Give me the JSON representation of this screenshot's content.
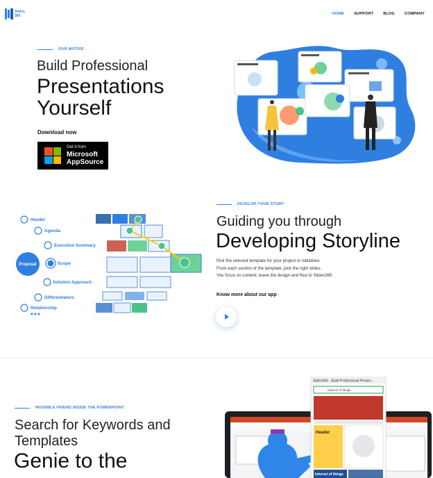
{
  "brand": {
    "logo_text_line1": "Slides",
    "logo_text_line2": "365"
  },
  "nav": {
    "items": [
      "HOME",
      "SUPPORT",
      "BLOG",
      "COMPANY"
    ],
    "active": "HOME"
  },
  "hero": {
    "eyebrow": "OUR MOTIVE",
    "line1": "Build Professional",
    "line2": "Presentations",
    "line3": "Yourself",
    "download_label": "Download now",
    "badge_small": "Get it from",
    "badge_big1": "Microsoft",
    "badge_big2": "AppSource"
  },
  "story": {
    "eyebrow": "DEVELOP YOUR STORY",
    "line1": "Guiding you through",
    "line2": "Developing Storyline",
    "body1": "Pick the relevant template for your project or initiatives",
    "body2": "From each section of the template, pick the right slides.",
    "body3": "You focus on content, leave the design and flow to Slides365",
    "know_more": "Know more about our app",
    "tree": {
      "header": "Header",
      "agenda": "Agenda",
      "exec": "Executive Summary",
      "proposal": "Proposal",
      "scope": "Scope",
      "solution": "Solution Approach",
      "diff": "Differentiators",
      "relationship": "Relationship"
    }
  },
  "genie": {
    "eyebrow": "INVISIBLE FRIEND INSIDE THE POWERPOINT",
    "line1": "Search for Keywords and",
    "line2": "Templates",
    "line3": "Genie to the",
    "pane_title": "Slides365 - Build Professional Presen...",
    "pane_search": "Internet of things",
    "card_header": "Header",
    "card_iot": "Internet of things"
  },
  "colors": {
    "accent": "#2f7fe0"
  }
}
